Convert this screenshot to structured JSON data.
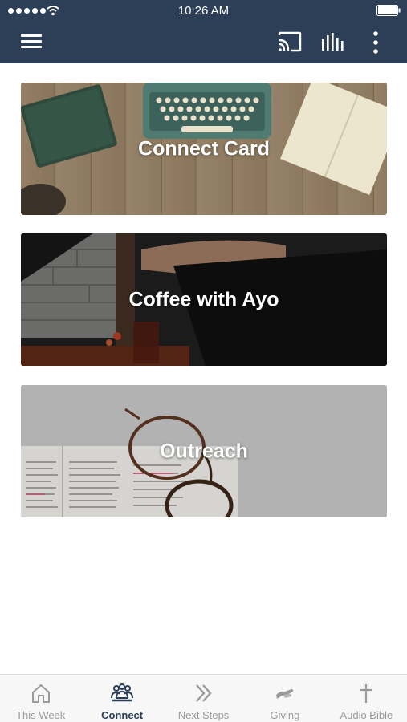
{
  "status_bar": {
    "time": "10:26 AM"
  },
  "header": {
    "menu_icon": "hamburger-icon",
    "cast_icon": "cast-icon",
    "equalizer_icon": "equalizer-icon",
    "more_icon": "more-vertical-icon",
    "background_color": "#2d3e57"
  },
  "cards": [
    {
      "title": "Connect Card"
    },
    {
      "title": "Coffee with Ayo"
    },
    {
      "title": "Outreach"
    }
  ],
  "tabs": [
    {
      "label": "This Week",
      "icon": "home-icon",
      "active": false
    },
    {
      "label": "Connect",
      "icon": "group-icon",
      "active": true
    },
    {
      "label": "Next Steps",
      "icon": "double-chevron-icon",
      "active": false
    },
    {
      "label": "Giving",
      "icon": "giving-hand-icon",
      "active": false
    },
    {
      "label": "Audio Bible",
      "icon": "cross-icon",
      "active": false
    }
  ],
  "colors": {
    "accent": "#2d3e57",
    "inactive": "#9a9a9a"
  }
}
